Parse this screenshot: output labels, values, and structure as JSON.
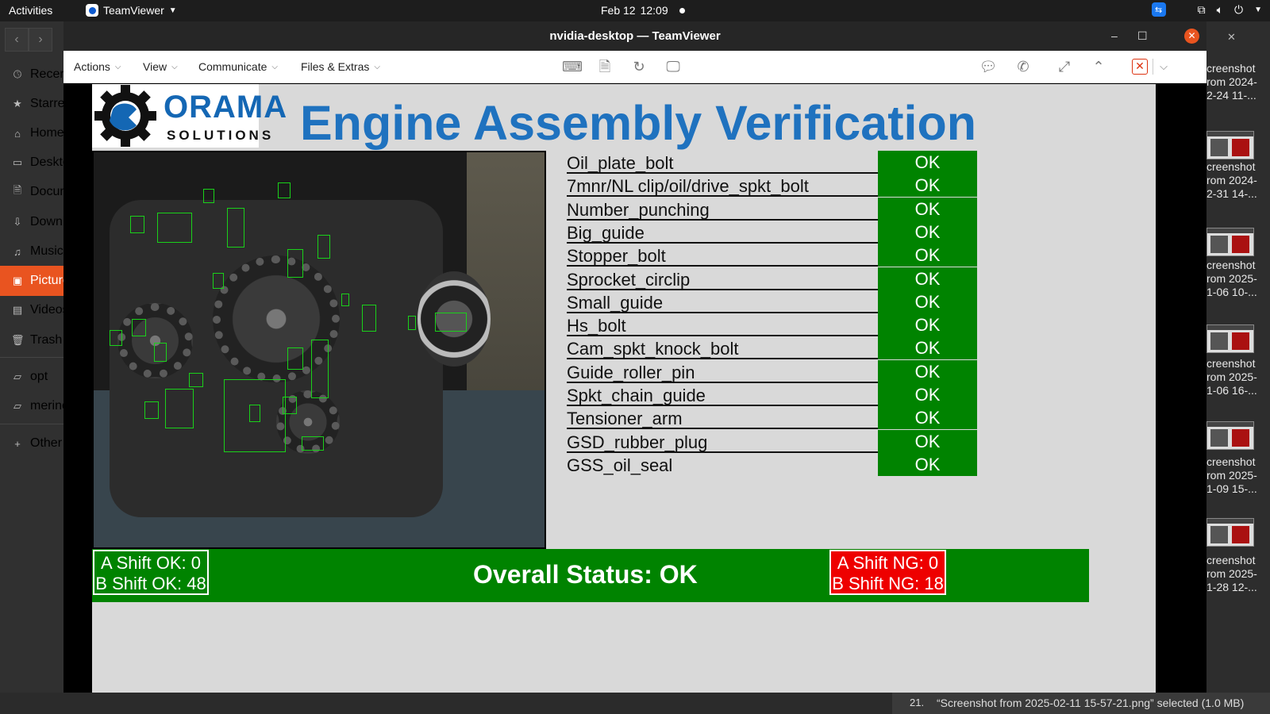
{
  "topbar": {
    "activities": "Activities",
    "app_name": "TeamViewer",
    "date": "Feb 12",
    "time": "12:09"
  },
  "file_manager": {
    "sidebar": [
      {
        "label": "Recent",
        "icon": "clock-icon"
      },
      {
        "label": "Starred",
        "icon": "star-icon"
      },
      {
        "label": "Home",
        "icon": "home-icon"
      },
      {
        "label": "Desktop",
        "icon": "desktop-icon"
      },
      {
        "label": "Documents",
        "icon": "document-icon"
      },
      {
        "label": "Downloads",
        "icon": "download-icon"
      },
      {
        "label": "Music",
        "icon": "music-icon"
      },
      {
        "label": "Pictures",
        "icon": "picture-icon"
      },
      {
        "label": "Videos",
        "icon": "video-icon"
      },
      {
        "label": "Trash",
        "icon": "trash-icon"
      },
      {
        "label": "opt",
        "icon": "folder-icon"
      },
      {
        "label": "merino",
        "icon": "folder-icon"
      },
      {
        "label": "Other Locations",
        "icon": "plus-icon"
      }
    ],
    "files": [
      {
        "line1": "creenshot",
        "line2": "rom 2024-",
        "line3": "2-24 11-..."
      },
      {
        "line1": "creenshot",
        "line2": "rom 2024-",
        "line3": "2-31 14-..."
      },
      {
        "line1": "creenshot",
        "line2": "rom 2025-",
        "line3": "1-06 10-..."
      },
      {
        "line1": "creenshot",
        "line2": "rom 2025-",
        "line3": "1-06 16-..."
      },
      {
        "line1": "creenshot",
        "line2": "rom 2025-",
        "line3": "1-09 15-..."
      },
      {
        "line1": "creenshot",
        "line2": "rom 2025-",
        "line3": "1-28 12-..."
      }
    ],
    "page_indicator": "21.",
    "selection_status": "“Screenshot from 2025-02-11 15-57-21.png” selected (1.0 MB)"
  },
  "teamviewer": {
    "window_title": "nvidia-desktop — TeamViewer",
    "menus": [
      "Actions",
      "View",
      "Communicate",
      "Files & Extras"
    ]
  },
  "app": {
    "logo_name": "ORAMA",
    "logo_sub": "SOLUTIONS",
    "title": "Engine Assembly Verification",
    "checks": [
      {
        "label": "Oil_plate_bolt",
        "status": "OK"
      },
      {
        "label": "7mnr/NL clip/oil/drive_spkt_bolt",
        "status": "OK"
      },
      {
        "label": "Number_punching",
        "status": "OK"
      },
      {
        "label": "Big_guide",
        "status": "OK"
      },
      {
        "label": "Stopper_bolt",
        "status": "OK"
      },
      {
        "label": "Sprocket_circlip",
        "status": "OK"
      },
      {
        "label": "Small_guide",
        "status": "OK"
      },
      {
        "label": "Hs_bolt",
        "status": "OK"
      },
      {
        "label": "Cam_spkt_knock_bolt",
        "status": "OK"
      },
      {
        "label": "Guide_roller_pin",
        "status": "OK"
      },
      {
        "label": "Spkt_chain_guide",
        "status": "OK"
      },
      {
        "label": "Tensioner_arm",
        "status": "OK"
      },
      {
        "label": "GSD_rubber_plug",
        "status": "OK"
      },
      {
        "label": "GSS_oil_seal",
        "status": "OK"
      }
    ],
    "a_shift_ok": "A Shift OK: 0",
    "b_shift_ok": "B Shift OK: 48",
    "overall_status": "Overall Status: OK",
    "a_shift_ng": "A Shift NG: 0",
    "b_shift_ng": "B Shift NG: 18",
    "colors": {
      "ok_green": "#008300",
      "ng_red": "#ee0000",
      "title_blue": "#1f72bf"
    }
  }
}
